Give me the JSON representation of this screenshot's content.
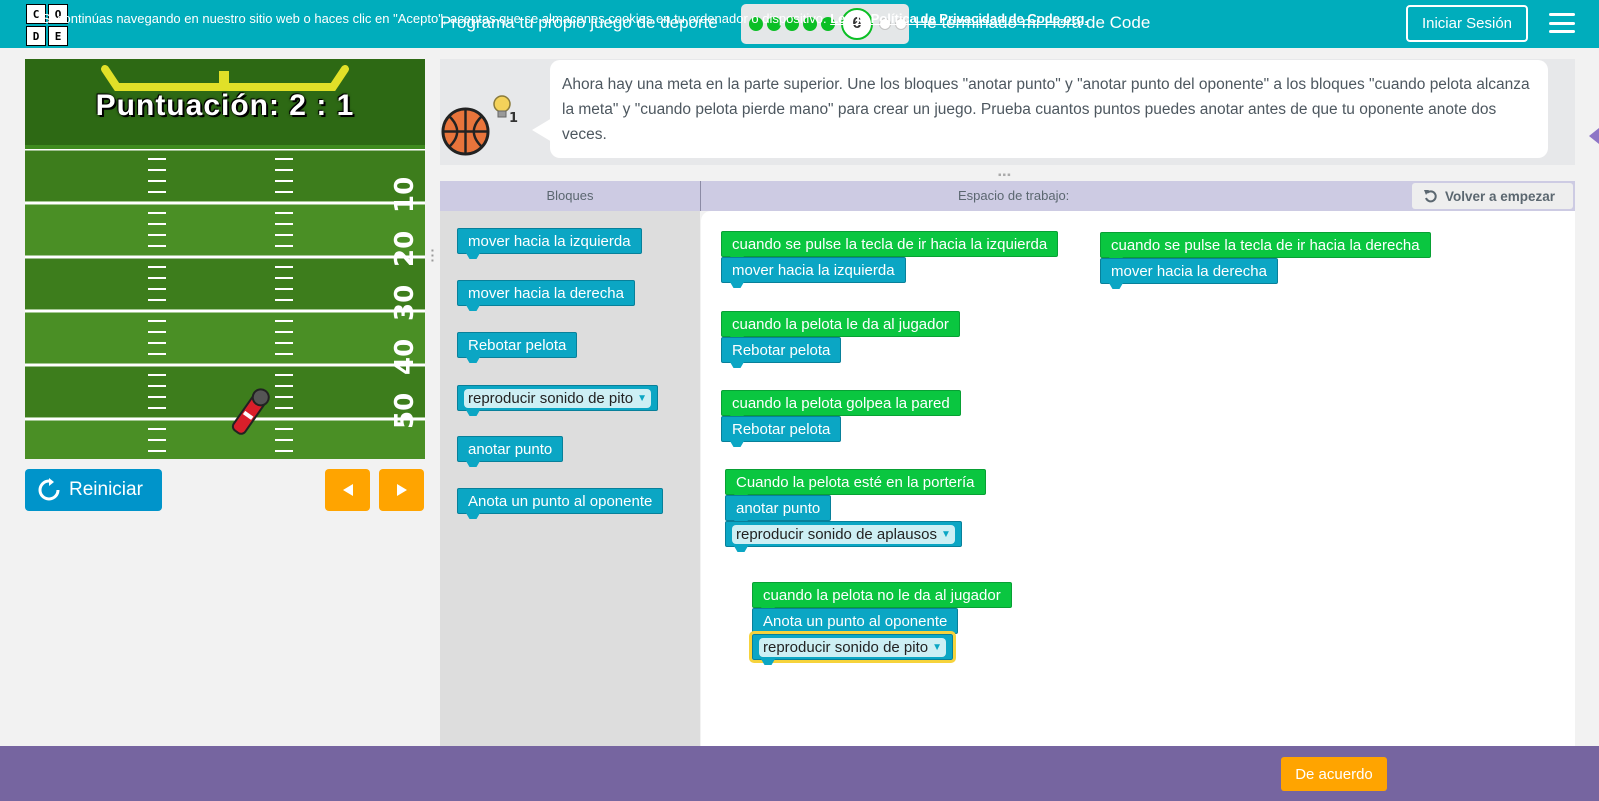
{
  "header": {
    "logo_letters": [
      "C",
      "O",
      "D",
      "E"
    ],
    "title": "Programa tu propio juego de deporte",
    "progress": {
      "completed": 5,
      "current": "6",
      "remaining": 2
    },
    "finish_link": "He terminado mi Hora de Code",
    "signin_label": "Iniciar Sesión",
    "menu_icon": "hamburger-icon",
    "accent_color": "#00adbc"
  },
  "game": {
    "score_text": "Puntuación: 2 : 1",
    "yard_numbers": [
      "10",
      "20",
      "30",
      "40",
      "50"
    ],
    "reset_label": "Reiniciar",
    "prev_icon": "triangle-left-icon",
    "next_icon": "triangle-right-icon"
  },
  "instructions": {
    "text": "Ahora hay una meta en la parte superior. Une los bloques \"anotar punto\" y \"anotar punto del oponente\" a los bloques \"cuando pelota alcanza la meta\" y \"cuando pelota pierde mano\" para crear un juego. Prueba cuantos puntos puedes anotar antes de que tu oponente anote dos veces.",
    "hint_count": "1",
    "avatar_icon": "basketball-icon",
    "hint_icon": "lightbulb-icon"
  },
  "workspace_header": {
    "blocks_label": "Bloques",
    "workspace_label": "Espacio de trabajo:",
    "restart_label": "Volver a empezar"
  },
  "toolbox": [
    {
      "label": "mover hacia la izquierda",
      "type": "teal"
    },
    {
      "label": "mover hacia la derecha",
      "type": "teal"
    },
    {
      "label": "Rebotar pelota",
      "type": "teal"
    },
    {
      "label": "reproducir sonido de pito",
      "type": "drop"
    },
    {
      "label": "anotar punto",
      "type": "teal"
    },
    {
      "label": "Anota un punto al oponente",
      "type": "teal"
    }
  ],
  "workspace_blocks": {
    "left_key_event": "cuando se pulse la tecla de ir hacia la izquierda",
    "left_key_action": "mover hacia la izquierda",
    "right_key_event": "cuando se pulse la tecla de ir hacia la derecha",
    "right_key_action": "mover hacia la derecha",
    "paddle_event": "cuando la pelota le da al jugador",
    "paddle_action": "Rebotar pelota",
    "wall_event": "cuando la pelota golpea la pared",
    "wall_action": "Rebotar pelota",
    "goal_event": "Cuando la pelota esté en la portería",
    "goal_action": "anotar punto",
    "goal_sound": "reproducir sonido de aplausos",
    "miss_event": "cuando la pelota no le da al jugador",
    "miss_action": "Anota un punto al oponente",
    "miss_sound": "reproducir sonido de pito"
  },
  "cookie": {
    "text": "Si continúas navegando en nuestro sitio web o haces clic en \"Acepto\", aceptas que se almacenes cookies en tu ordenador o dispositivo.",
    "link": "Lee la Política de Privacidad de Code.org.",
    "button": "De acuerdo"
  }
}
